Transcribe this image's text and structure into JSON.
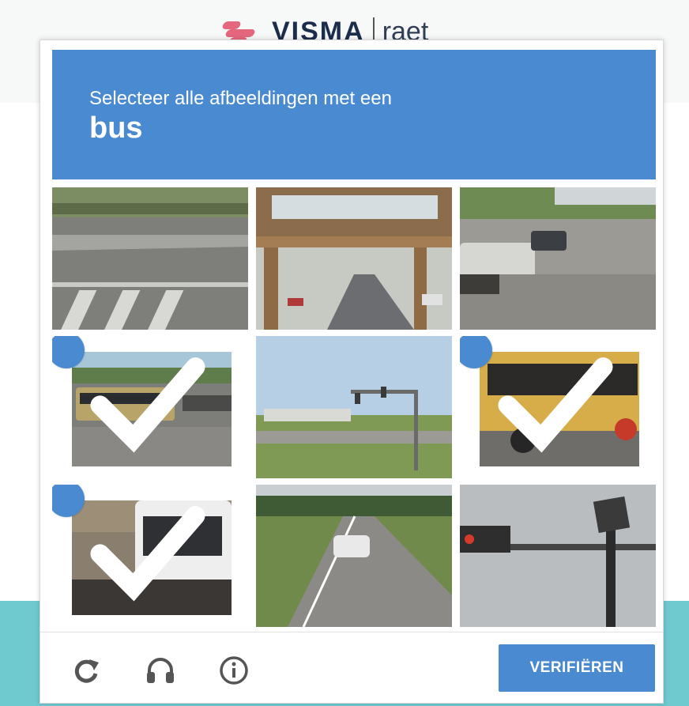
{
  "background": {
    "logo_text": "VISMA",
    "logo_sub": "raet"
  },
  "header": {
    "instruction": "Selecteer alle afbeeldingen met een",
    "target": "bus"
  },
  "tiles": [
    {
      "subject": "street crosswalk",
      "selected": false
    },
    {
      "subject": "elevated rail over road",
      "selected": false
    },
    {
      "subject": "parked cars on street",
      "selected": false
    },
    {
      "subject": "articulated bus",
      "selected": true
    },
    {
      "subject": "traffic lights at intersection",
      "selected": false
    },
    {
      "subject": "yellow school bus",
      "selected": true
    },
    {
      "subject": "white coach bus",
      "selected": true
    },
    {
      "subject": "highway with car",
      "selected": false
    },
    {
      "subject": "traffic light pole",
      "selected": false
    }
  ],
  "footer": {
    "reload_icon": "reload-icon",
    "audio_icon": "headphones-icon",
    "info_icon": "info-icon",
    "verify_label": "VERIFIËREN"
  },
  "colors": {
    "accent": "#4a8ad0",
    "teal": "#6fcad0"
  }
}
